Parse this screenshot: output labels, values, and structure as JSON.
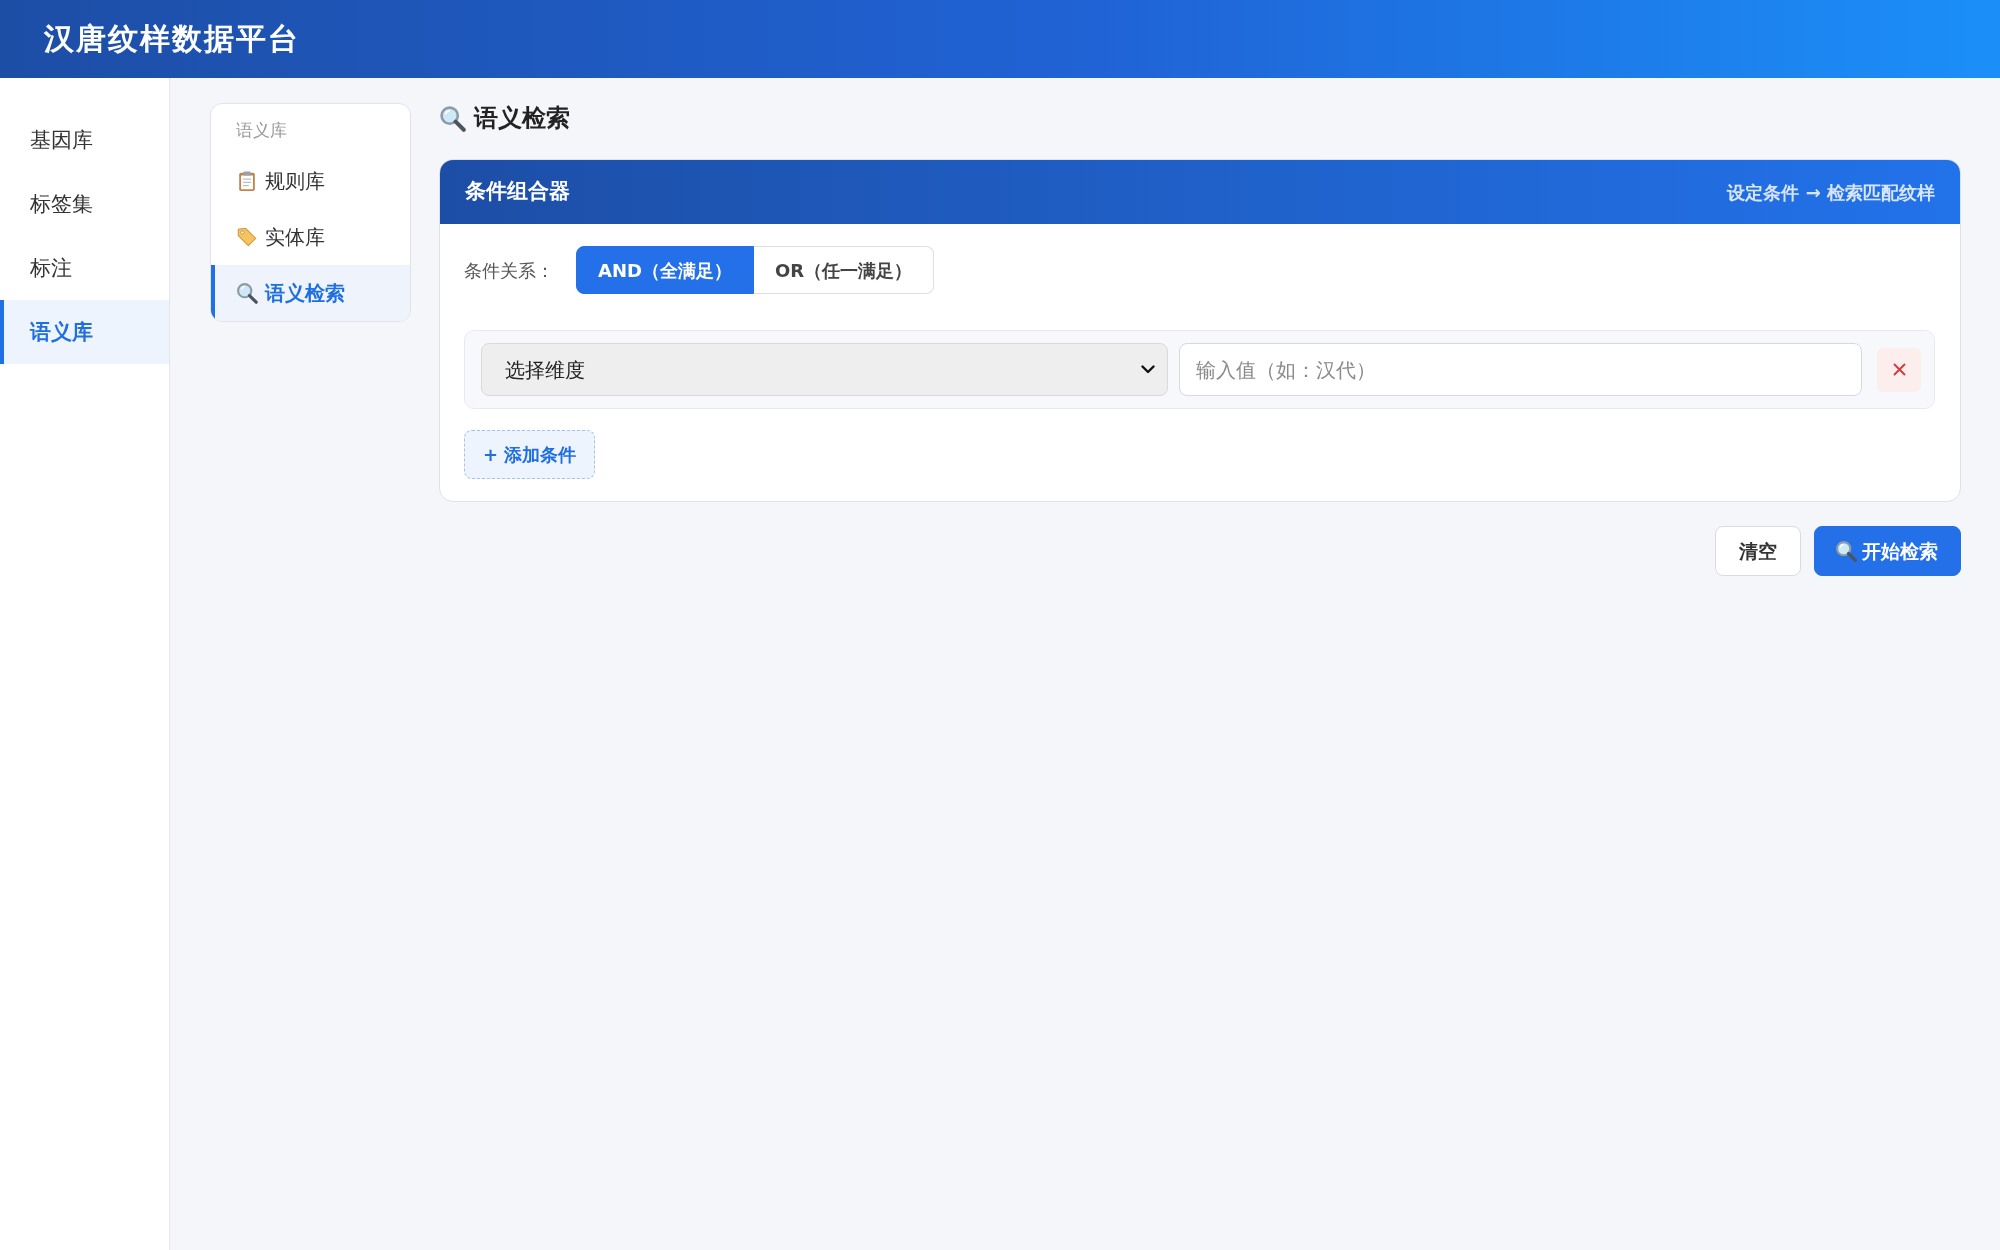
{
  "header": {
    "title": "汉唐纹样数据平台"
  },
  "sidebar": {
    "items": [
      {
        "label": "基因库",
        "selected": false
      },
      {
        "label": "标签集",
        "selected": false
      },
      {
        "label": "标注",
        "selected": false
      },
      {
        "label": "语义库",
        "selected": true
      }
    ]
  },
  "subnav": {
    "heading": "语义库",
    "items": [
      {
        "label": "规则库",
        "selected": false
      },
      {
        "label": "实体库",
        "selected": false
      },
      {
        "label": "语义检索",
        "selected": true
      }
    ]
  },
  "page_title": "语义检索",
  "condition_builder": {
    "title": "条件组合器",
    "hint": "设定条件 → 检索匹配纹样",
    "relation_label": "条件关系：",
    "relation_options": [
      {
        "label": "AND（全满足）",
        "selected": true
      },
      {
        "label": "OR（任一满足）",
        "selected": false
      }
    ],
    "conditions": [
      {
        "dimension": "选择维度",
        "placeholder": "输入值（如：汉代）"
      }
    ],
    "add_button": "+ 添加条件"
  },
  "actions": [
    {
      "label": "清空",
      "kind": "secondary"
    },
    {
      "label": "开始检索",
      "kind": "primary"
    }
  ]
}
